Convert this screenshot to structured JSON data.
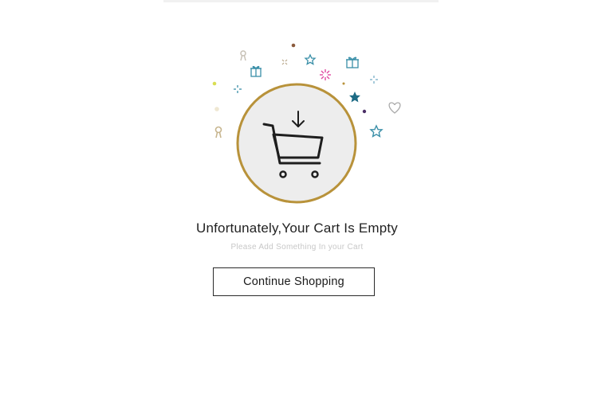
{
  "empty_state": {
    "title": "Unfortunately,Your Cart Is Empty",
    "subtitle": "Please Add Something In your Cart",
    "button_label": "Continue Shopping"
  },
  "illustration": {
    "main_icon": "shopping-cart-icon",
    "badge_icon": "arrow-down-icon",
    "decorations": [
      "gift-icon",
      "star-icon",
      "sparkle-icon",
      "heart-icon",
      "ribbon-icon",
      "confetti-icon"
    ]
  },
  "colors": {
    "circle_border": "#b8923a",
    "circle_fill": "#ededed",
    "star_teal": "#3a8fa8",
    "star_dark": "#1d6b85",
    "sparkle_pink": "#e04aa2",
    "text": "#222222",
    "muted_text": "#c7c7c7"
  }
}
